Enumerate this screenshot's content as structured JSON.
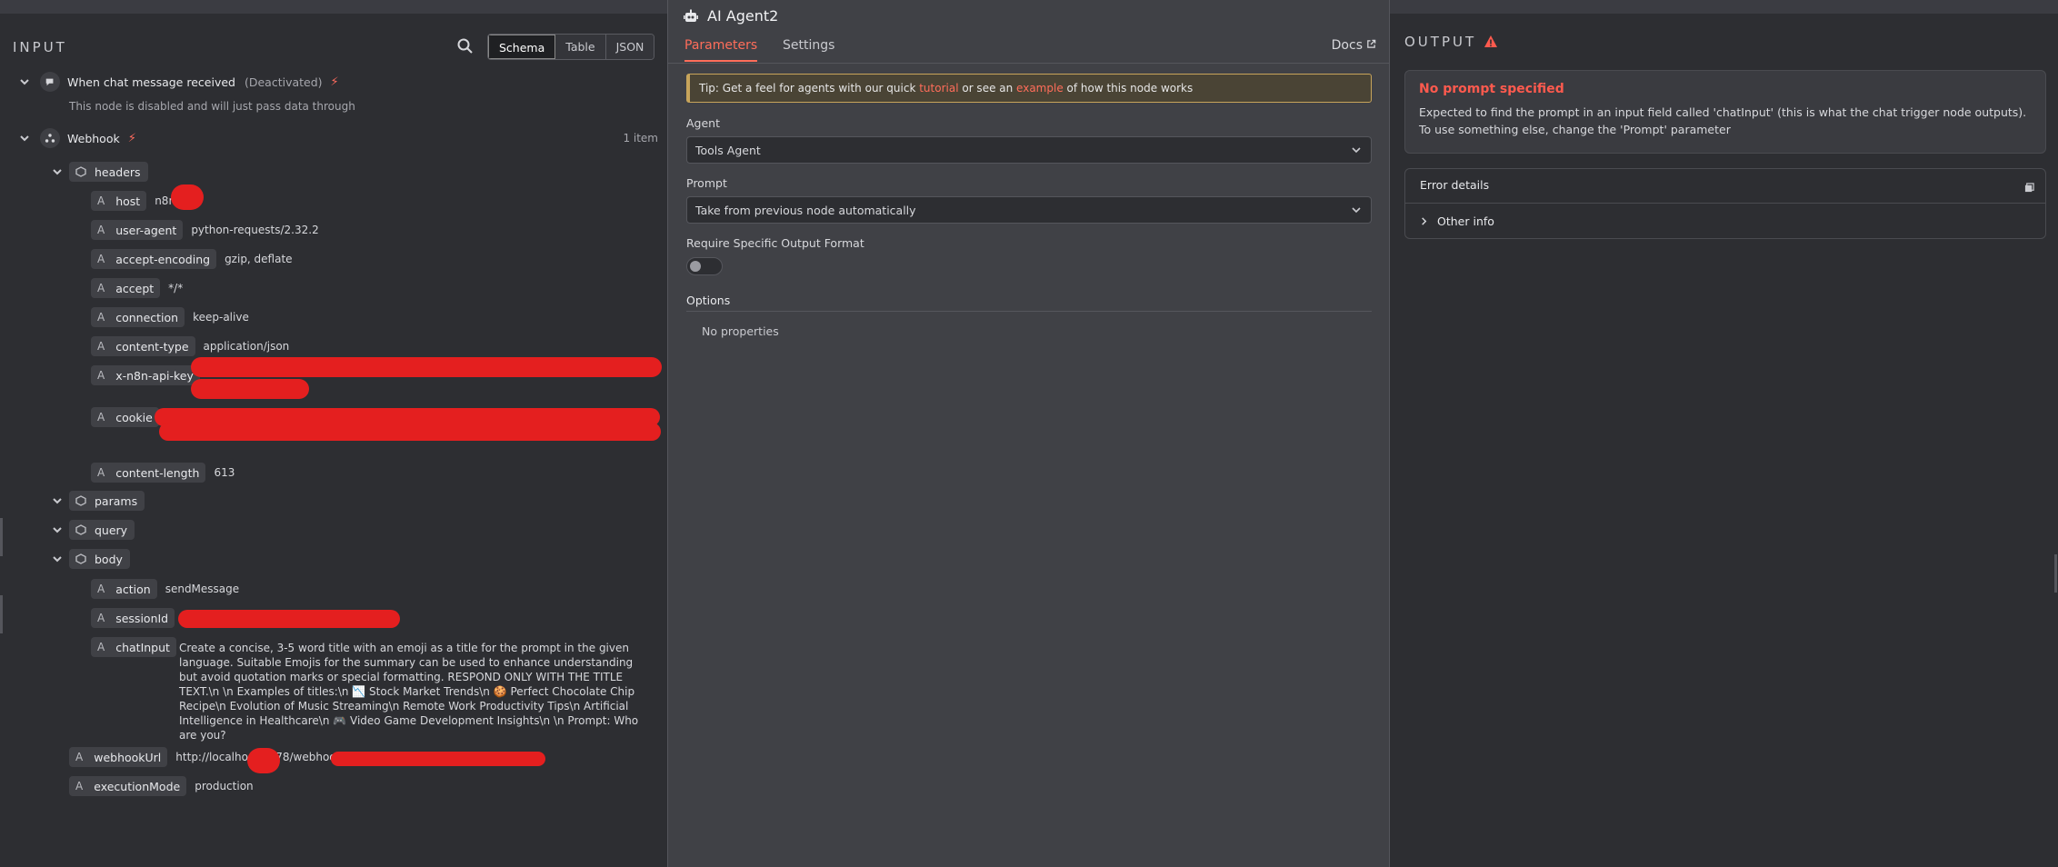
{
  "input": {
    "title": "INPUT",
    "view_tabs": [
      "Schema",
      "Table",
      "JSON"
    ],
    "active_view": "Schema",
    "chat_node": {
      "name": "When chat message received",
      "status": "(Deactivated)",
      "note": "This node is disabled and will just pass data through"
    },
    "webhook_node": {
      "name": "Webhook",
      "count": "1 item"
    },
    "headers_label": "headers",
    "headers": [
      {
        "key": "host",
        "value": "n8n"
      },
      {
        "key": "user-agent",
        "value": "python-requests/2.32.2"
      },
      {
        "key": "accept-encoding",
        "value": "gzip, deflate"
      },
      {
        "key": "accept",
        "value": "*/*"
      },
      {
        "key": "connection",
        "value": "keep-alive"
      },
      {
        "key": "content-type",
        "value": "application/json"
      },
      {
        "key": "x-n8n-api-key",
        "value": ""
      },
      {
        "key": "cookie",
        "value": ""
      },
      {
        "key": "content-length",
        "value": "613"
      }
    ],
    "params_label": "params",
    "query_label": "query",
    "body_label": "body",
    "body": [
      {
        "key": "action",
        "value": "sendMessage"
      },
      {
        "key": "sessionId",
        "value": ""
      },
      {
        "key": "chatInput",
        "value": "Create a concise, 3-5 word title with an emoji as a title for the prompt in the given language. Suitable Emojis for the summary can be used to enhance understanding but avoid quotation marks or special formatting. RESPOND ONLY WITH THE TITLE TEXT.\\n \\n Examples of titles:\\n 📉 Stock Market Trends\\n 🍪 Perfect Chocolate Chip Recipe\\n Evolution of Music Streaming\\n Remote Work Productivity Tips\\n Artificial Intelligence in Healthcare\\n 🎮 Video Game Development Insights\\n \\n Prompt: Who are you?"
      }
    ],
    "webhookUrl": {
      "key": "webhookUrl",
      "value": "http://localhost:5678/webhook/"
    },
    "executionMode": {
      "key": "executionMode",
      "value": "production"
    }
  },
  "node": {
    "title": "AI Agent2",
    "tabs": [
      "Parameters",
      "Settings"
    ],
    "docs": "Docs",
    "tip": {
      "prefix": "Tip: Get a feel for agents with our quick ",
      "link1": "tutorial",
      "middle": " or see an ",
      "link2": "example",
      "suffix": " of how this node works"
    },
    "agent_label": "Agent",
    "agent_value": "Tools Agent",
    "prompt_label": "Prompt",
    "prompt_value": "Take from previous node automatically",
    "output_format_label": "Require Specific Output Format",
    "options_label": "Options",
    "no_properties": "No properties"
  },
  "output": {
    "title": "OUTPUT",
    "error_title": "No prompt specified",
    "error_message": "Expected to find the prompt in an input field called 'chatInput' (this is what the chat trigger node outputs). To use something else, change the 'Prompt' parameter",
    "details_label": "Error details",
    "other_info": "Other info"
  },
  "colors": {
    "accent": "#ff6d5a",
    "error": "#ff5a4e",
    "redaction": "#e41f1f"
  }
}
